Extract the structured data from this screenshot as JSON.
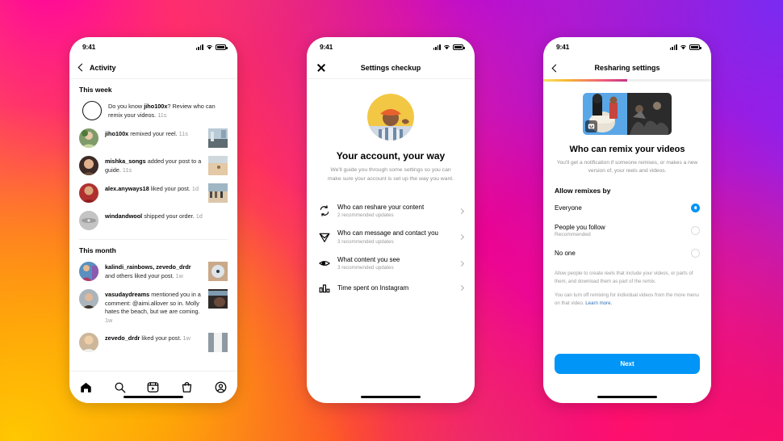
{
  "background": {
    "gradient_colors": [
      "#FFC500",
      "#FF9500",
      "#FF5A1F",
      "#FA2E6B",
      "#E6009B",
      "#D400C8",
      "#A020F0",
      "#6A1BE0"
    ]
  },
  "accent": {
    "blue": "#0095F6",
    "link": "#2f6fb5",
    "muted": "#9a9a9a"
  },
  "phone1": {
    "status": {
      "time": "9:41"
    },
    "nav": {
      "title": "Activity"
    },
    "sections": [
      {
        "heading": "This week",
        "rows": [
          {
            "avatar": "ring",
            "text_parts": [
              "Do you know ",
              "jiho100x",
              "? Review who can remix your videos. "
            ],
            "time": "11s",
            "thumb": false
          },
          {
            "avatar": "photo",
            "text_parts": [
              "",
              "jiho100x",
              " remixed your reel. "
            ],
            "time": "11s",
            "thumb": true
          },
          {
            "avatar": "photo",
            "text_parts": [
              "",
              "mishka_songs",
              " added your post to a guide. "
            ],
            "time": "11s",
            "thumb": true
          },
          {
            "avatar": "photo",
            "text_parts": [
              "",
              "alex.anyways18",
              " liked your post. "
            ],
            "time": "1d",
            "thumb": true
          },
          {
            "avatar": "photo",
            "text_parts": [
              "",
              "windandwool",
              " shipped your order. "
            ],
            "time": "1d",
            "thumb": false
          }
        ]
      },
      {
        "heading": "This month",
        "rows": [
          {
            "avatar": "photo",
            "text_parts": [
              "",
              "kalindi_rainbows, zevedo_drdr",
              " and others liked your post. "
            ],
            "time": "1w",
            "thumb": true
          },
          {
            "avatar": "photo",
            "text_parts": [
              "",
              "vasudaydreams",
              " mentioned you in a comment: @aimi.allover so in. Molly hates the beach, but we are coming. "
            ],
            "time": "1w",
            "thumb": true
          },
          {
            "avatar": "photo",
            "text_parts": [
              "",
              "zevedo_drdr",
              " liked your post. "
            ],
            "time": "1w",
            "thumb": true
          }
        ]
      }
    ],
    "tabbar": [
      {
        "name": "home-icon",
        "label": "Home"
      },
      {
        "name": "search-icon",
        "label": "Search"
      },
      {
        "name": "reels-icon",
        "label": "Reels"
      },
      {
        "name": "shop-icon",
        "label": "Shop"
      },
      {
        "name": "profile-icon",
        "label": "Profile"
      }
    ]
  },
  "phone2": {
    "status": {
      "time": "9:41"
    },
    "nav": {
      "title": "Settings checkup",
      "close": "Close"
    },
    "hero": {
      "title": "Your account, your way",
      "subtitle": "We'll guide you through some settings so you can make sure your account is set up the way you want."
    },
    "options": [
      {
        "icon": "reshare-icon",
        "title": "Who can reshare your content",
        "subtitle": "2 recommended updates"
      },
      {
        "icon": "send-icon",
        "title": "Who can message and contact you",
        "subtitle": "3 recommended updates"
      },
      {
        "icon": "eye-icon",
        "title": "What content you see",
        "subtitle": "3 recommended updates"
      },
      {
        "icon": "bars-icon",
        "title": "Time spent on Instagram",
        "subtitle": ""
      }
    ]
  },
  "phone3": {
    "status": {
      "time": "9:41"
    },
    "nav": {
      "title": "Resharing settings"
    },
    "progress_percent": 50,
    "hero": {
      "title": "Who can remix your videos",
      "subtitle": "You'll get a notification if someone remixes, or makes a new version of, your reels and videos."
    },
    "section_heading": "Allow remixes by",
    "radio_options": [
      {
        "label": "Everyone",
        "sublabel": "",
        "selected": true
      },
      {
        "label": "People you follow",
        "sublabel": "Recommended",
        "selected": false
      },
      {
        "label": "No one",
        "sublabel": "",
        "selected": false
      }
    ],
    "notes": [
      "Allow people to create reels that include your videos, or parts of them, and download them as part of the remix.",
      "You can turn off remixing for individual videos from the more menu on that video. "
    ],
    "learn_more": "Learn more.",
    "next_button": "Next"
  }
}
